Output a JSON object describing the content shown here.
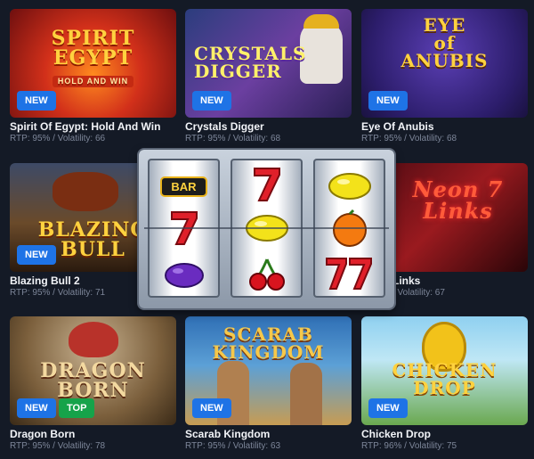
{
  "colors": {
    "background": "#141a26",
    "new_badge": "#1e73e6",
    "top_badge": "#16a34a",
    "meta_text": "#7d8699"
  },
  "games": [
    {
      "title": "Spirit Of Egypt: Hold And Win",
      "meta": "RTP: 95% / Volatility: 66",
      "logo": "SPIRIT\nEGYPT",
      "logo_sub": "HOLD AND WIN",
      "badges": [
        "NEW"
      ]
    },
    {
      "title": "Crystals Digger",
      "meta": "RTP: 95% / Volatility: 68",
      "logo": "CRYSTALS\nDIGGER",
      "badges": [
        "NEW"
      ]
    },
    {
      "title": "Eye Of Anubis",
      "meta": "RTP: 95% / Volatility: 68",
      "logo": "EYE\nof\nANUBIS",
      "badges": [
        "NEW"
      ]
    },
    {
      "title": "Blazing Bull 2",
      "meta": "RTP: 95% / Volatility: 71",
      "logo": "BLAZING\nBULL",
      "badges": [
        "NEW"
      ]
    },
    {
      "title": "Links",
      "meta": "/ Volatility: 67",
      "logo": "Neon 7\nLinks",
      "badges": []
    },
    {
      "title": "Dragon Born",
      "meta": "RTP: 95% / Volatility: 78",
      "logo": "DRAGON\nBORN",
      "badges": [
        "NEW",
        "TOP"
      ]
    },
    {
      "title": "Scarab Kingdom",
      "meta": "RTP: 95% / Volatility: 63",
      "logo": "SCARAB\nKINGDOM",
      "badges": [
        "NEW"
      ]
    },
    {
      "title": "Chicken Drop",
      "meta": "RTP: 96% / Volatility: 75",
      "logo": "CHICKEN\nDROP",
      "badges": [
        "NEW"
      ]
    }
  ],
  "slot_machine": {
    "bar_label": "BAR",
    "reels": [
      [
        "bar",
        "seven",
        "plum"
      ],
      [
        "seven",
        "lemon",
        "cherries"
      ],
      [
        "lemon",
        "orange",
        "double-seven"
      ]
    ]
  }
}
